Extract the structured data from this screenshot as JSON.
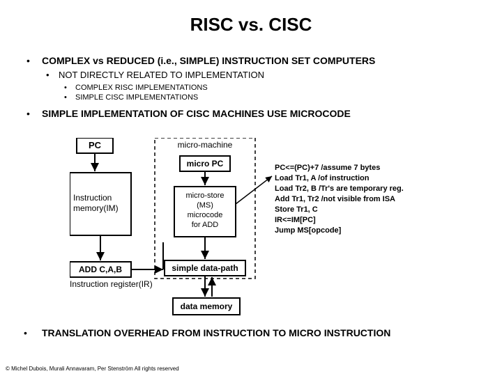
{
  "title": "RISC vs. CISC",
  "bullets": {
    "b1": "COMPLEX vs REDUCED (i.e., SIMPLE) INSTRUCTION SET COMPUTERS",
    "b1_1": "NOT DIRECTLY RELATED TO IMPLEMENTATION",
    "b1_1_1": "COMPLEX RISC IMPLEMENTATIONS",
    "b1_1_2": "SIMPLE CISC IMPLEMENTATIONS",
    "b2": "SIMPLE IMPLEMENTATION OF CISC MACHINES USE MICROCODE",
    "b3": "TRANSLATION OVERHEAD FROM INSTRUCTION TO MICRO INSTRUCTION"
  },
  "diagram": {
    "pc": "PC",
    "imem": "Instruction\nmemory(IM)",
    "addinst": "ADD C,A,B",
    "ir": "Instruction register(IR)",
    "micromachine": "micro-machine",
    "micropc": "micro PC",
    "microstore": "micro-store\n(MS)\nmicrocode\nfor ADD",
    "datapath": "simple data-path",
    "datamem": "data memory",
    "code": {
      "l1": "PC<=(PC)+7  /assume 7 bytes",
      "l2": "Load Tr1, A   /of instruction",
      "l3": "Load Tr2, B  /Tr's are temporary reg.",
      "l4": "Add Tr1, Tr2 /not visible from ISA",
      "l5": "Store Tr1, C",
      "l6": "IR<=IM[PC]",
      "l7": "Jump MS[opcode]"
    }
  },
  "footer": "© Michel Dubois, Murali Annavaram, Per Stenström All rights reserved"
}
